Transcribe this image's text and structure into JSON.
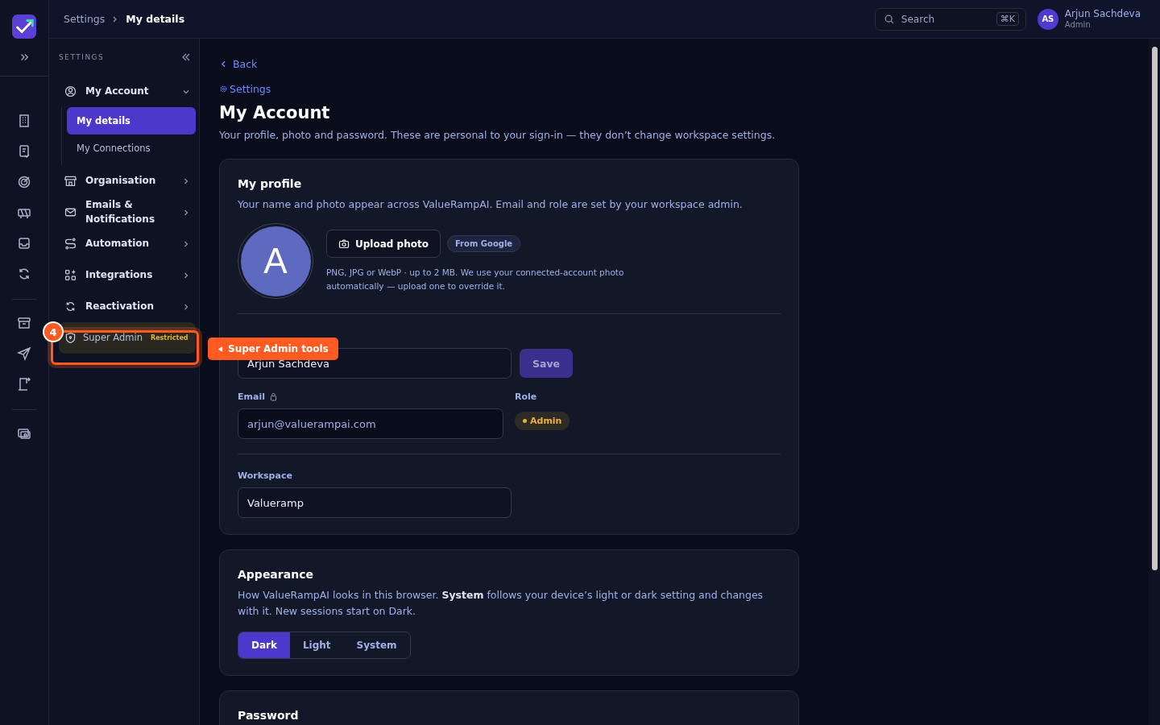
{
  "breadcrumb": [
    {
      "label": "Settings",
      "current": false
    },
    {
      "label": "My details",
      "current": true
    }
  ],
  "search": {
    "placeholder": "Search",
    "shortcut": "⌘K"
  },
  "user": {
    "initials": "AS",
    "name": "Arjun Sachdeva",
    "role": "Admin"
  },
  "settings_nav": {
    "heading": "SETTINGS",
    "items": [
      {
        "label": "My Account",
        "kind": "section",
        "expanded": true,
        "children": [
          {
            "label": "My details",
            "selected": true
          },
          {
            "label": "My Connections",
            "selected": false
          }
        ]
      },
      {
        "label": "Organisation",
        "kind": "section",
        "expanded": false
      },
      {
        "label": "Emails & Notifications",
        "kind": "section",
        "expanded": false
      },
      {
        "label": "Automation",
        "kind": "section",
        "expanded": false
      },
      {
        "label": "Integrations",
        "kind": "section",
        "expanded": false
      },
      {
        "label": "Reactivation",
        "kind": "section",
        "expanded": false
      },
      {
        "label": "Super Admin",
        "kind": "restricted",
        "badge": "Restricted"
      }
    ]
  },
  "tour": {
    "step": "4",
    "tooltip": "Super Admin tools"
  },
  "page": {
    "back": "Back",
    "eyebrow": "Settings",
    "title": "My Account",
    "subtitle": "Your profile, photo and password. These are personal to your sign-in — they don’t change workspace settings."
  },
  "profile": {
    "title": "My profile",
    "description": "Your name and photo appear across ValueRampAI. Email and role are set by your workspace admin.",
    "avatar_letter": "A",
    "upload_button": "Upload photo",
    "source_badge": "From Google",
    "hint": "PNG, JPG or WebP · up to 2 MB. We use your connected-account photo automatically — upload one to override it.",
    "name_value": "Arjun Sachdeva",
    "save_button": {
      "label": "Save",
      "disabled": true
    },
    "email_label": "Email",
    "email_locked": true,
    "email_value": "arjun@valuerampai.com",
    "role_label": "Role",
    "role_badge": "Admin",
    "workspace_label": "Workspace",
    "workspace_value": "Valueramp"
  },
  "appearance": {
    "title": "Appearance",
    "description": "How ValueRampAI looks in this browser. **System** follows your device’s light or dark setting and changes with it. New sessions start on Dark.",
    "options": [
      {
        "label": "Dark",
        "selected": true
      },
      {
        "label": "Light",
        "selected": false
      },
      {
        "label": "System",
        "selected": false
      }
    ]
  },
  "password": {
    "title": "Password"
  }
}
